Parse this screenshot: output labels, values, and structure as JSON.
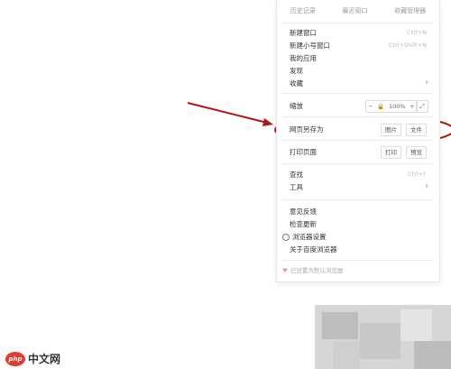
{
  "top_row": [
    "历史记录",
    "最近窗口",
    "收藏管理器"
  ],
  "items": {
    "new_window": {
      "label": "新建窗口",
      "shortcut": "Ctrl+N"
    },
    "new_small_window": {
      "label": "新建小号窗口",
      "shortcut": "Ctrl+Shift+N"
    },
    "my_apps": {
      "label": "我的应用"
    },
    "discover": {
      "label": "发现"
    },
    "favorites": {
      "label": "收藏"
    },
    "zoom": {
      "label": "缩放",
      "minus": "−",
      "value": "100%",
      "plus": "+"
    },
    "save_page_as": {
      "label": "网页另存为",
      "image_btn": "图片",
      "file_btn": "文件"
    },
    "print_page": {
      "label": "打印页面",
      "print_btn": "打印",
      "preview_btn": "预览"
    },
    "find": {
      "label": "查找",
      "shortcut": "Ctrl+F"
    },
    "tools": {
      "label": "工具"
    },
    "feedback": {
      "label": "意见反馈"
    },
    "check_update": {
      "label": "检查更新"
    },
    "browser_settings": {
      "label": "浏览器设置"
    },
    "about": {
      "label": "关于百度浏览器"
    }
  },
  "default_browser_note": "已设置为默认浏览器",
  "watermark": {
    "badge": "php",
    "text": "中文网"
  },
  "colors": {
    "annotation_red": "#b01818",
    "logo_red": "#e43b2b"
  }
}
